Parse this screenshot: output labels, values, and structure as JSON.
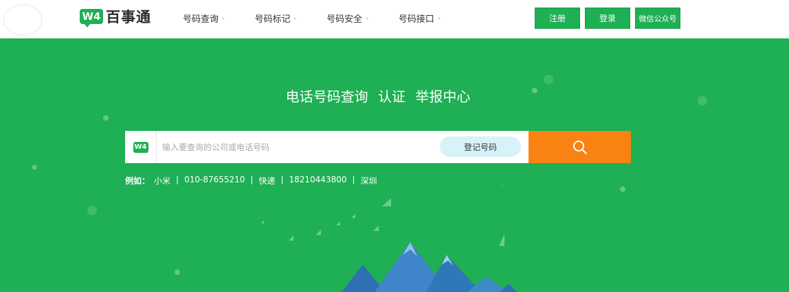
{
  "header": {
    "logo_badge": "W4",
    "logo_text": "百事通",
    "nav": [
      {
        "label": "号码查询"
      },
      {
        "label": "号码标记"
      },
      {
        "label": "号码安全"
      },
      {
        "label": "号码接口"
      }
    ],
    "register_label": "注册",
    "login_label": "登录",
    "wechat_label": "微信公众号"
  },
  "hero": {
    "title_parts": [
      "电话号码查询",
      "认证",
      "举报中心"
    ],
    "search_logo": "W4",
    "search_placeholder": "输入要查询的公司或电话号码",
    "register_number_label": "登记号码",
    "examples_label": "例如：",
    "examples": [
      "小米",
      "010-87655210",
      "快递",
      "18210443800",
      "深圳"
    ]
  },
  "colors": {
    "brand_green": "#1faf54",
    "search_orange": "#f98213",
    "pill_blue": "#d7f3f9"
  }
}
